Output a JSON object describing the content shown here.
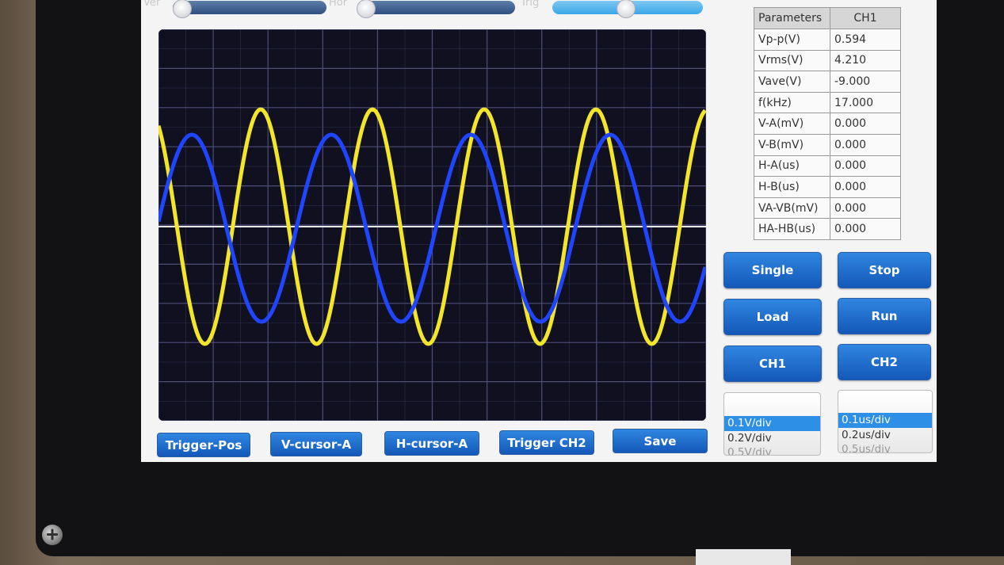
{
  "sliders": {
    "ver_label": "Ver",
    "hor_label": "Hor",
    "trig_label": "Trig"
  },
  "parameters": {
    "header_param": "Parameters",
    "header_ch": "CH1",
    "rows": [
      {
        "name": "Vp-p(V)",
        "value": "0.594"
      },
      {
        "name": "Vrms(V)",
        "value": "4.210"
      },
      {
        "name": "Vave(V)",
        "value": "-9.000"
      },
      {
        "name": "f(kHz)",
        "value": "17.000"
      },
      {
        "name": "V-A(mV)",
        "value": "0.000"
      },
      {
        "name": "V-B(mV)",
        "value": "0.000"
      },
      {
        "name": "H-A(us)",
        "value": "0.000"
      },
      {
        "name": "H-B(us)",
        "value": "0.000"
      },
      {
        "name": "VA-VB(mV)",
        "value": "0.000"
      },
      {
        "name": "HA-HB(us)",
        "value": "0.000"
      }
    ]
  },
  "buttons": {
    "single": "Single",
    "stop": "Stop",
    "load": "Load",
    "run": "Run",
    "ch1": "CH1",
    "ch2": "CH2"
  },
  "bottom_buttons": {
    "trigger_pos": "Trigger-Pos",
    "v_cursor_a": "V-cursor-A",
    "h_cursor_a": "H-cursor-A",
    "trigger_ch2": "Trigger CH2",
    "save": "Save"
  },
  "volt_div": {
    "selected": "0.1V/div",
    "next": "0.2V/div",
    "partial": "0.5V/div"
  },
  "time_div": {
    "selected": "0.1us/div",
    "next": "0.2us/div",
    "partial": "0.5us/div"
  },
  "colors": {
    "trace_ch1": "#f2e52a",
    "trace_ch2": "#1f45ff",
    "grid": "#4d4d78",
    "plot_bg": "#101020",
    "button_blue": "#1f6fd0"
  }
}
